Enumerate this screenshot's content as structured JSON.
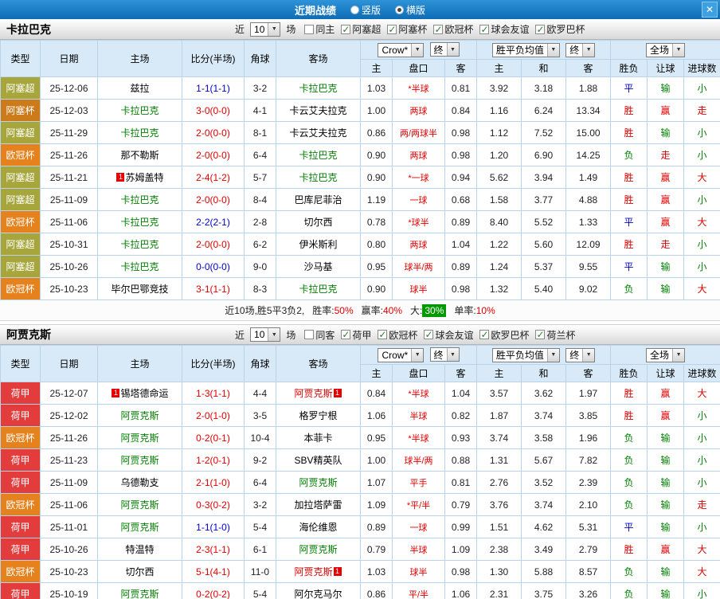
{
  "titlebar": {
    "title": "近期战绩",
    "vertical_label": "竖版",
    "horizontal_label": "横版",
    "selected_layout": "横版",
    "close_glyph": "✕"
  },
  "icons": {
    "check": "✓",
    "arrow_down": "▼"
  },
  "colors": {
    "r": "#dd0000",
    "g": "#008000",
    "b": "#0000cc",
    "k": "#000000",
    "text": "#222222"
  },
  "league_colors": {
    "阿塞超": "#a6a63c",
    "阿塞杯": "#cc7a1a",
    "欧冠杯": "#e5821d",
    "荷甲": "#e23c3c"
  },
  "common": {
    "near_label": "近",
    "games_label": "场",
    "odds_source": "Crow*",
    "final_label": "终",
    "avg_label": "胜平负均值",
    "scope_label": "全场",
    "col_headers": [
      "类型",
      "日期",
      "主场",
      "比分(半场)",
      "角球",
      "客场"
    ],
    "sub_headers": [
      "主",
      "盘口",
      "客",
      "主",
      "和",
      "客",
      "胜负",
      "让球",
      "进球数"
    ]
  },
  "sections": [
    {
      "team": "卡拉巴克",
      "recent_count": "10",
      "filters": [
        {
          "label": "同主",
          "checked": false
        },
        {
          "label": "阿塞超",
          "checked": true
        },
        {
          "label": "阿塞杯",
          "checked": true
        },
        {
          "label": "欧冠杯",
          "checked": true
        },
        {
          "label": "球会友谊",
          "checked": true
        },
        {
          "label": "欧罗巴杯",
          "checked": true
        }
      ],
      "rows": [
        {
          "league": "阿塞超",
          "date": "25-12-06",
          "home": {
            "name": "兹拉",
            "color": "k"
          },
          "score": "1-1(1-1)",
          "score_color": "b",
          "corners": "3-2",
          "away": {
            "name": "卡拉巴克",
            "color": "g"
          },
          "odds": [
            "1.03",
            "*半球",
            "0.81"
          ],
          "avg": [
            "3.92",
            "3.18",
            "1.88"
          ],
          "res": [
            [
              "平",
              "b"
            ],
            [
              "输",
              "g"
            ],
            [
              "小",
              "g"
            ]
          ]
        },
        {
          "league": "阿塞杯",
          "date": "25-12-03",
          "home": {
            "name": "卡拉巴克",
            "color": "g"
          },
          "score": "3-0(0-0)",
          "score_color": "r",
          "corners": "4-1",
          "away": {
            "name": "卡云艾夫拉克",
            "color": "k"
          },
          "odds": [
            "1.00",
            "两球",
            "0.84"
          ],
          "avg": [
            "1.16",
            "6.24",
            "13.34"
          ],
          "res": [
            [
              "胜",
              "r"
            ],
            [
              "赢",
              "r"
            ],
            [
              "走",
              "r"
            ]
          ]
        },
        {
          "league": "阿塞超",
          "date": "25-11-29",
          "home": {
            "name": "卡拉巴克",
            "color": "g"
          },
          "score": "2-0(0-0)",
          "score_color": "r",
          "corners": "8-1",
          "away": {
            "name": "卡云艾夫拉克",
            "color": "k"
          },
          "odds": [
            "0.86",
            "两/两球半",
            "0.98"
          ],
          "avg": [
            "1.12",
            "7.52",
            "15.00"
          ],
          "res": [
            [
              "胜",
              "r"
            ],
            [
              "输",
              "g"
            ],
            [
              "小",
              "g"
            ]
          ]
        },
        {
          "league": "欧冠杯",
          "date": "25-11-26",
          "home": {
            "name": "那不勒斯",
            "color": "k"
          },
          "score": "2-0(0-0)",
          "score_color": "r",
          "corners": "6-4",
          "away": {
            "name": "卡拉巴克",
            "color": "g"
          },
          "odds": [
            "0.90",
            "两球",
            "0.98"
          ],
          "avg": [
            "1.20",
            "6.90",
            "14.25"
          ],
          "res": [
            [
              "负",
              "g"
            ],
            [
              "走",
              "r"
            ],
            [
              "小",
              "g"
            ]
          ]
        },
        {
          "league": "阿塞超",
          "date": "25-11-21",
          "home": {
            "name": "苏姆盖特",
            "color": "k",
            "rc": "1"
          },
          "score": "2-4(1-2)",
          "score_color": "r",
          "corners": "5-7",
          "away": {
            "name": "卡拉巴克",
            "color": "g"
          },
          "odds": [
            "0.90",
            "*一球",
            "0.94"
          ],
          "avg": [
            "5.62",
            "3.94",
            "1.49"
          ],
          "res": [
            [
              "胜",
              "r"
            ],
            [
              "赢",
              "r"
            ],
            [
              "大",
              "r"
            ]
          ]
        },
        {
          "league": "阿塞超",
          "date": "25-11-09",
          "home": {
            "name": "卡拉巴克",
            "color": "g"
          },
          "score": "2-0(0-0)",
          "score_color": "r",
          "corners": "8-4",
          "away": {
            "name": "巴库尼菲治",
            "color": "k"
          },
          "odds": [
            "1.19",
            "一球",
            "0.68"
          ],
          "avg": [
            "1.58",
            "3.77",
            "4.88"
          ],
          "res": [
            [
              "胜",
              "r"
            ],
            [
              "赢",
              "r"
            ],
            [
              "小",
              "g"
            ]
          ]
        },
        {
          "league": "欧冠杯",
          "date": "25-11-06",
          "home": {
            "name": "卡拉巴克",
            "color": "g"
          },
          "score": "2-2(2-1)",
          "score_color": "b",
          "corners": "2-8",
          "away": {
            "name": "切尔西",
            "color": "k"
          },
          "odds": [
            "0.78",
            "*球半",
            "0.89"
          ],
          "avg": [
            "8.40",
            "5.52",
            "1.33"
          ],
          "res": [
            [
              "平",
              "b"
            ],
            [
              "赢",
              "r"
            ],
            [
              "大",
              "r"
            ]
          ]
        },
        {
          "league": "阿塞超",
          "date": "25-10-31",
          "home": {
            "name": "卡拉巴克",
            "color": "g"
          },
          "score": "2-0(0-0)",
          "score_color": "r",
          "corners": "6-2",
          "away": {
            "name": "伊米斯利",
            "color": "k"
          },
          "odds": [
            "0.80",
            "两球",
            "1.04"
          ],
          "avg": [
            "1.22",
            "5.60",
            "12.09"
          ],
          "res": [
            [
              "胜",
              "r"
            ],
            [
              "走",
              "r"
            ],
            [
              "小",
              "g"
            ]
          ]
        },
        {
          "league": "阿塞超",
          "date": "25-10-26",
          "home": {
            "name": "卡拉巴克",
            "color": "g"
          },
          "score": "0-0(0-0)",
          "score_color": "b",
          "corners": "9-0",
          "away": {
            "name": "沙马基",
            "color": "k"
          },
          "odds": [
            "0.95",
            "球半/两",
            "0.89"
          ],
          "avg": [
            "1.24",
            "5.37",
            "9.55"
          ],
          "res": [
            [
              "平",
              "b"
            ],
            [
              "输",
              "g"
            ],
            [
              "小",
              "g"
            ]
          ]
        },
        {
          "league": "欧冠杯",
          "date": "25-10-23",
          "home": {
            "name": "毕尔巴鄂竞技",
            "color": "k"
          },
          "score": "3-1(1-1)",
          "score_color": "r",
          "corners": "8-3",
          "away": {
            "name": "卡拉巴克",
            "color": "g"
          },
          "odds": [
            "0.90",
            "球半",
            "0.98"
          ],
          "avg": [
            "1.32",
            "5.40",
            "9.02"
          ],
          "res": [
            [
              "负",
              "g"
            ],
            [
              "输",
              "g"
            ],
            [
              "大",
              "r"
            ]
          ]
        }
      ],
      "summary": {
        "text": "近10场,胜5平3负2,",
        "items": [
          {
            "label": "胜率:",
            "value": "50%",
            "green_bg": false
          },
          {
            "label": "赢率:",
            "value": "40%",
            "green_bg": false
          },
          {
            "label": "大:",
            "value": "30%",
            "green_bg": true
          },
          {
            "label": "单率:",
            "value": "10%",
            "green_bg": false
          }
        ]
      }
    },
    {
      "team": "阿贾克斯",
      "recent_count": "10",
      "filters": [
        {
          "label": "同客",
          "checked": false
        },
        {
          "label": "荷甲",
          "checked": true
        },
        {
          "label": "欧冠杯",
          "checked": true
        },
        {
          "label": "球会友谊",
          "checked": true
        },
        {
          "label": "欧罗巴杯",
          "checked": true
        },
        {
          "label": "荷兰杯",
          "checked": true
        }
      ],
      "rows": [
        {
          "league": "荷甲",
          "date": "25-12-07",
          "home": {
            "name": "锡塔德命运",
            "color": "k",
            "rc": "1"
          },
          "score": "1-3(1-1)",
          "score_color": "r",
          "corners": "4-4",
          "away": {
            "name": "阿贾克斯",
            "color": "r",
            "rc": "1"
          },
          "odds": [
            "0.84",
            "*半球",
            "1.04"
          ],
          "avg": [
            "3.57",
            "3.62",
            "1.97"
          ],
          "res": [
            [
              "胜",
              "r"
            ],
            [
              "赢",
              "r"
            ],
            [
              "大",
              "r"
            ]
          ]
        },
        {
          "league": "荷甲",
          "date": "25-12-02",
          "home": {
            "name": "阿贾克斯",
            "color": "g"
          },
          "score": "2-0(1-0)",
          "score_color": "r",
          "corners": "3-5",
          "away": {
            "name": "格罗宁根",
            "color": "k"
          },
          "odds": [
            "1.06",
            "半球",
            "0.82"
          ],
          "avg": [
            "1.87",
            "3.74",
            "3.85"
          ],
          "res": [
            [
              "胜",
              "r"
            ],
            [
              "赢",
              "r"
            ],
            [
              "小",
              "g"
            ]
          ]
        },
        {
          "league": "欧冠杯",
          "date": "25-11-26",
          "home": {
            "name": "阿贾克斯",
            "color": "g"
          },
          "score": "0-2(0-1)",
          "score_color": "r",
          "corners": "10-4",
          "away": {
            "name": "本菲卡",
            "color": "k"
          },
          "odds": [
            "0.95",
            "*半球",
            "0.93"
          ],
          "avg": [
            "3.74",
            "3.58",
            "1.96"
          ],
          "res": [
            [
              "负",
              "g"
            ],
            [
              "输",
              "g"
            ],
            [
              "小",
              "g"
            ]
          ]
        },
        {
          "league": "荷甲",
          "date": "25-11-23",
          "home": {
            "name": "阿贾克斯",
            "color": "g"
          },
          "score": "1-2(0-1)",
          "score_color": "r",
          "corners": "9-2",
          "away": {
            "name": "SBV精英队",
            "color": "k"
          },
          "odds": [
            "1.00",
            "球半/两",
            "0.88"
          ],
          "avg": [
            "1.31",
            "5.67",
            "7.82"
          ],
          "res": [
            [
              "负",
              "g"
            ],
            [
              "输",
              "g"
            ],
            [
              "小",
              "g"
            ]
          ]
        },
        {
          "league": "荷甲",
          "date": "25-11-09",
          "home": {
            "name": "乌德勒支",
            "color": "k"
          },
          "score": "2-1(1-0)",
          "score_color": "r",
          "corners": "6-4",
          "away": {
            "name": "阿贾克斯",
            "color": "g"
          },
          "odds": [
            "1.07",
            "平手",
            "0.81"
          ],
          "avg": [
            "2.76",
            "3.52",
            "2.39"
          ],
          "res": [
            [
              "负",
              "g"
            ],
            [
              "输",
              "g"
            ],
            [
              "小",
              "g"
            ]
          ]
        },
        {
          "league": "欧冠杯",
          "date": "25-11-06",
          "home": {
            "name": "阿贾克斯",
            "color": "g"
          },
          "score": "0-3(0-2)",
          "score_color": "r",
          "corners": "3-2",
          "away": {
            "name": "加拉塔萨雷",
            "color": "k"
          },
          "odds": [
            "1.09",
            "*平/半",
            "0.79"
          ],
          "avg": [
            "3.76",
            "3.74",
            "2.10"
          ],
          "res": [
            [
              "负",
              "g"
            ],
            [
              "输",
              "g"
            ],
            [
              "走",
              "r"
            ]
          ]
        },
        {
          "league": "荷甲",
          "date": "25-11-01",
          "home": {
            "name": "阿贾克斯",
            "color": "g"
          },
          "score": "1-1(1-0)",
          "score_color": "b",
          "corners": "5-4",
          "away": {
            "name": "海伦维恩",
            "color": "k"
          },
          "odds": [
            "0.89",
            "一球",
            "0.99"
          ],
          "avg": [
            "1.51",
            "4.62",
            "5.31"
          ],
          "res": [
            [
              "平",
              "b"
            ],
            [
              "输",
              "g"
            ],
            [
              "小",
              "g"
            ]
          ]
        },
        {
          "league": "荷甲",
          "date": "25-10-26",
          "home": {
            "name": "特温特",
            "color": "k"
          },
          "score": "2-3(1-1)",
          "score_color": "r",
          "corners": "6-1",
          "away": {
            "name": "阿贾克斯",
            "color": "g"
          },
          "odds": [
            "0.79",
            "半球",
            "1.09"
          ],
          "avg": [
            "2.38",
            "3.49",
            "2.79"
          ],
          "res": [
            [
              "胜",
              "r"
            ],
            [
              "赢",
              "r"
            ],
            [
              "大",
              "r"
            ]
          ]
        },
        {
          "league": "欧冠杯",
          "date": "25-10-23",
          "home": {
            "name": "切尔西",
            "color": "k"
          },
          "score": "5-1(4-1)",
          "score_color": "r",
          "corners": "11-0",
          "away": {
            "name": "阿贾克斯",
            "color": "r",
            "rc": "1"
          },
          "odds": [
            "1.03",
            "球半",
            "0.98"
          ],
          "avg": [
            "1.30",
            "5.88",
            "8.57"
          ],
          "res": [
            [
              "负",
              "g"
            ],
            [
              "输",
              "g"
            ],
            [
              "大",
              "r"
            ]
          ]
        },
        {
          "league": "荷甲",
          "date": "25-10-19",
          "home": {
            "name": "阿贾克斯",
            "color": "g"
          },
          "score": "0-2(0-2)",
          "score_color": "r",
          "corners": "5-4",
          "away": {
            "name": "阿尔克马尔",
            "color": "k"
          },
          "odds": [
            "0.86",
            "平/半",
            "1.06"
          ],
          "avg": [
            "2.31",
            "3.75",
            "3.26"
          ],
          "res": [
            [
              "负",
              "g"
            ],
            [
              "输",
              "g"
            ],
            [
              "小",
              "g"
            ]
          ]
        }
      ],
      "summary": null
    }
  ]
}
